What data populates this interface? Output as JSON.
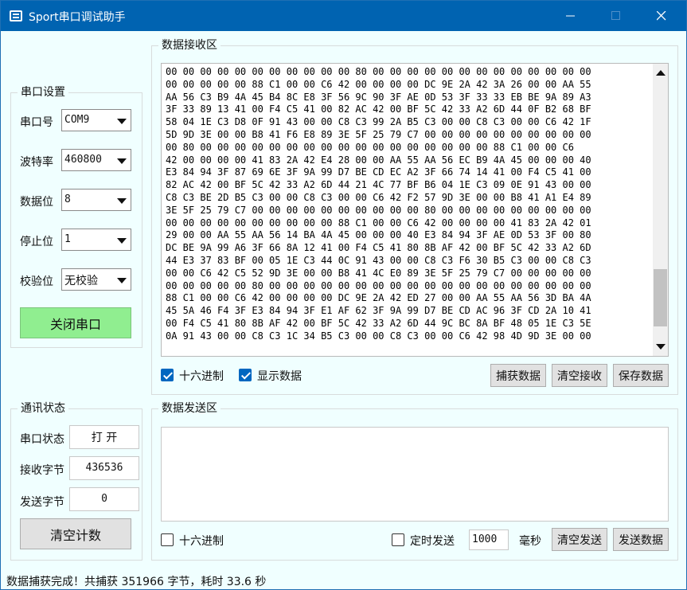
{
  "window": {
    "title": "Sport串口调试助手"
  },
  "serial_settings": {
    "title": "串口设置",
    "port": {
      "label": "串口号",
      "value": "COM9"
    },
    "baud": {
      "label": "波特率",
      "value": "460800"
    },
    "databits": {
      "label": "数据位",
      "value": "8"
    },
    "stopbits": {
      "label": "停止位",
      "value": "1"
    },
    "parity": {
      "label": "校验位",
      "value": "无校验"
    },
    "toggle_button": "关闭串口"
  },
  "receive": {
    "title": "数据接收区",
    "text": "00 00 00 00 00 00 00 00 00 00 00 80 00 00 00 00 00 00 00 00 00 00 00 00 00\n00 00 00 00 00 88 C1 00 00 C6 42 00 00 00 00 DC 9E 2A 42 3A 26 00 00 AA 55\nAA 56 C3 B9 4A 45 B4 8C E8 3F 56 9C 90 3F AE 0D 53 3F 33 33 EB BE 9A 89 A3\n3F 33 89 13 41 00 F4 C5 41 00 82 AC 42 00 BF 5C 42 33 A2 6D 44 0F B2 68 BF\n58 04 1E C3 D8 0F 91 43 00 00 C8 C3 99 2A B5 C3 00 00 C8 C3 00 00 C6 42 1F\n5D 9D 3E 00 00 B8 41 F6 E8 89 3E 5F 25 79 C7 00 00 00 00 00 00 00 00 00 00\n00 80 00 00 00 00 00 00 00 00 00 00 00 00 00 00 00 00 00 88 C1 00 00 C6\n42 00 00 00 00 41 83 2A 42 E4 28 00 00 AA 55 AA 56 EC B9 4A 45 00 00 00 40\nE3 84 94 3F 87 69 6E 3F 9A 99 D7 BE CD EC A2 3F 66 74 14 41 00 F4 C5 41 00\n82 AC 42 00 BF 5C 42 33 A2 6D 44 21 4C 77 BF B6 04 1E C3 09 0E 91 43 00 00\nC8 C3 BE 2D B5 C3 00 00 C8 C3 00 00 C6 42 F2 57 9D 3E 00 00 B8 41 A1 E4 89\n3E 5F 25 79 C7 00 00 00 00 00 00 00 00 00 00 80 00 00 00 00 00 00 00 00 00\n00 00 00 00 00 00 00 00 00 00 88 C1 00 00 C6 42 00 00 00 00 41 83 2A 42 01\n29 00 00 AA 55 AA 56 14 BA 4A 45 00 00 00 40 E3 84 94 3F AE 0D 53 3F 00 80\nDC BE 9A 99 A6 3F 66 8A 12 41 00 F4 C5 41 80 8B AF 42 00 BF 5C 42 33 A2 6D\n44 E3 37 83 BF 00 05 1E C3 44 0C 91 43 00 00 C8 C3 F6 30 B5 C3 00 00 C8 C3\n00 00 C6 42 C5 52 9D 3E 00 00 B8 41 4C E0 89 3E 5F 25 79 C7 00 00 00 00 00\n00 00 00 00 00 80 00 00 00 00 00 00 00 00 00 00 00 00 00 00 00 00 00 00 00\n88 C1 00 00 C6 42 00 00 00 00 DC 9E 2A 42 ED 27 00 00 AA 55 AA 56 3D BA 4A\n45 5A 46 F4 3F E3 84 94 3F E1 AF 62 3F 9A 99 D7 BE CD AC 96 3F CD 2A 10 41\n00 F4 C5 41 80 8B AF 42 00 BF 5C 42 33 A2 6D 44 9C BC 8A BF 48 05 1E C3 5E\n0A 91 43 00 00 C8 C3 1C 34 B5 C3 00 00 C8 C3 00 00 C6 42 98 4D 9D 3E 00 00",
    "hex_mode": {
      "label": "十六进制",
      "checked": true
    },
    "show_data": {
      "label": "显示数据",
      "checked": true
    },
    "capture_button": "捕获数据",
    "clear_button": "清空接收",
    "save_button": "保存数据"
  },
  "comm_status": {
    "title": "通讯状态",
    "port_status": {
      "label": "串口状态",
      "value": "打 开"
    },
    "rx_bytes": {
      "label": "接收字节",
      "value": "436536"
    },
    "tx_bytes": {
      "label": "发送字节",
      "value": "0"
    },
    "clear_count_button": "清空计数"
  },
  "send": {
    "title": "数据发送区",
    "text": "",
    "hex_mode": {
      "label": "十六进制",
      "checked": false
    },
    "timed_send": {
      "label": "定时发送",
      "checked": false
    },
    "interval": "1000",
    "interval_unit": "毫秒",
    "clear_button": "清空发送",
    "send_button": "发送数据"
  },
  "status_bar": {
    "message": "数据捕获完成！共捕获 351966 字节，耗时 33.6 秒"
  },
  "colors": {
    "titlebar": "#0063b1",
    "window_bg": "#f0ffff",
    "toggle_button_bg": "#90ee90",
    "checkbox_checked": "#0067c0"
  }
}
